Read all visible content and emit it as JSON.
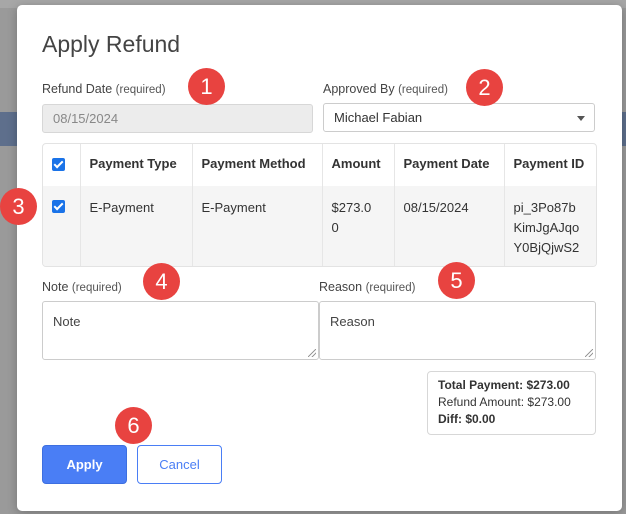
{
  "dialog": {
    "title": "Apply Refund"
  },
  "refund_date": {
    "label": "Refund Date",
    "required_tag": "(required)",
    "value": "08/15/2024"
  },
  "approved_by": {
    "label": "Approved By",
    "required_tag": "(required)",
    "value": "Michael Fabian"
  },
  "payments_table": {
    "columns": [
      "Payment Type",
      "Payment Method",
      "Amount",
      "Payment Date",
      "Payment ID"
    ],
    "rows": [
      {
        "payment_type": "E-Payment",
        "payment_method": "E-Payment",
        "amount_line1": "$273.0",
        "amount_line2": "0",
        "payment_date": "08/15/2024",
        "payment_id_line1": "pi_3Po87b",
        "payment_id_line2": "KimJgAJqo",
        "payment_id_line3": "Y0BjQjwS2"
      }
    ]
  },
  "note": {
    "label": "Note",
    "required_tag": "(required)",
    "placeholder": "Note"
  },
  "reason": {
    "label": "Reason",
    "required_tag": "(required)",
    "placeholder": "Reason"
  },
  "summary": {
    "total_payment": "Total Payment: $273.00",
    "refund_amount": "Refund Amount: $273.00",
    "diff": "Diff: $0.00"
  },
  "buttons": {
    "apply": "Apply",
    "cancel": "Cancel"
  },
  "callouts": [
    "1",
    "2",
    "3",
    "4",
    "5",
    "6"
  ],
  "colors": {
    "accent": "#4a7ef5",
    "callout": "#e84340",
    "checkbox": "#1a73e8"
  }
}
